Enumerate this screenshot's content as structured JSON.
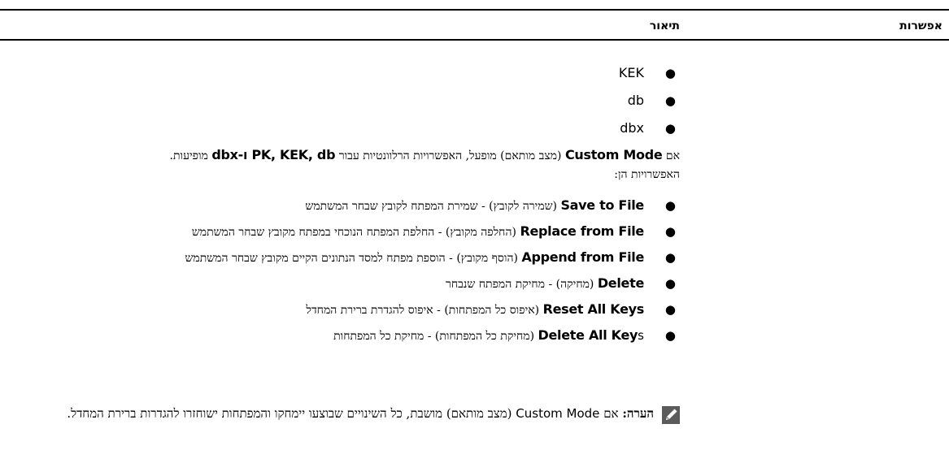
{
  "table": {
    "header_option": "אפשרות",
    "header_description": "תיאור"
  },
  "keys": [
    "KEK",
    "db",
    "dbx"
  ],
  "paragraph": {
    "lead": "אם",
    "custom_mode": "Custom Mode",
    "middle": "(מצב מותאם) מופעל, האפשרויות הרלוונטיות עבור",
    "key_list": "PK, KEK, db ו-dbx",
    "tail": "מופיעות.",
    "line2": "האפשרויות הן:"
  },
  "options": [
    {
      "label": "Save to File",
      "desc": "(שמירה לקובץ) - שמירת המפתח לקובץ שבחר המשתמש",
      "suffix": ""
    },
    {
      "label": "Replace from File",
      "desc": "(החלפה מקובץ) - החלפת המפתח הנוכחי במפתח מקובץ שבחר המשתמש",
      "suffix": ""
    },
    {
      "label": "Append from File",
      "desc": "(הוסף מקובץ) - הוספת מפתח למסד הנתונים הקיים מקובץ שבחר המשתמש",
      "suffix": ""
    },
    {
      "label": "Delete",
      "desc": "(מחיקה) - מחיקת המפתח שנבחר",
      "suffix": ""
    },
    {
      "label": "Reset All Keys",
      "desc": "(איפוס כל המפתחות) - איפוס להגדרת ברירת המחדל",
      "suffix": ""
    },
    {
      "label": "Delete All Key",
      "suffix": "s",
      "desc": "(מחיקת כל המפתחות) - מחיקת כל המפתחות"
    }
  ],
  "note": {
    "label": "הערה:",
    "lead": "אם",
    "mode": "Custom Mode",
    "text": "(מצב מותאם) מושבת, כל השינויים שבוצעו יימחקו והמפתחות ישוחזרו להגדרות ברירת המחדל.",
    "icon": "pencil-note-icon"
  }
}
